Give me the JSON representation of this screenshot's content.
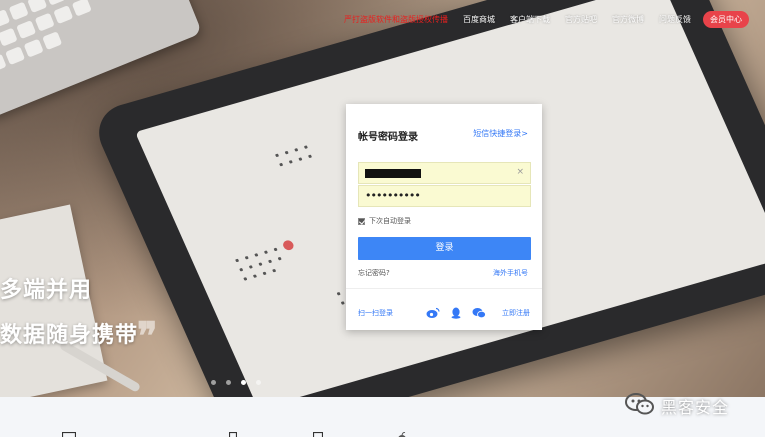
{
  "topnav": {
    "promo": "严打盗版软件和盗版授权传播",
    "items": [
      "百度商城",
      "客户端下载",
      "官方贴吧",
      "官方微博",
      "问题反馈"
    ],
    "vip": "会员中心"
  },
  "hero": {
    "slogan_line1": "多端并用",
    "slogan_line2": "数据随身携带",
    "quote": "❞",
    "carousel_total": 4,
    "carousel_active": 3
  },
  "login": {
    "title": "帐号密码登录",
    "sms_link": "短信快捷登录>",
    "password_dots": "••••••••••",
    "clear": "×",
    "remember": "下次自动登录",
    "submit": "登录",
    "forgot": "忘记密码?",
    "overseas": "海外手机号",
    "scan": "扫一扫登录",
    "register": "立即注册",
    "social_icons": [
      "weibo-icon",
      "qq-icon",
      "wechat-icon"
    ]
  },
  "watermark": {
    "text": "黑客安全"
  },
  "colors": {
    "accent": "#3d86f6",
    "link": "#3478f6",
    "promo": "#e8201f",
    "vip": "#e8434a",
    "autofill": "#fafad2"
  }
}
